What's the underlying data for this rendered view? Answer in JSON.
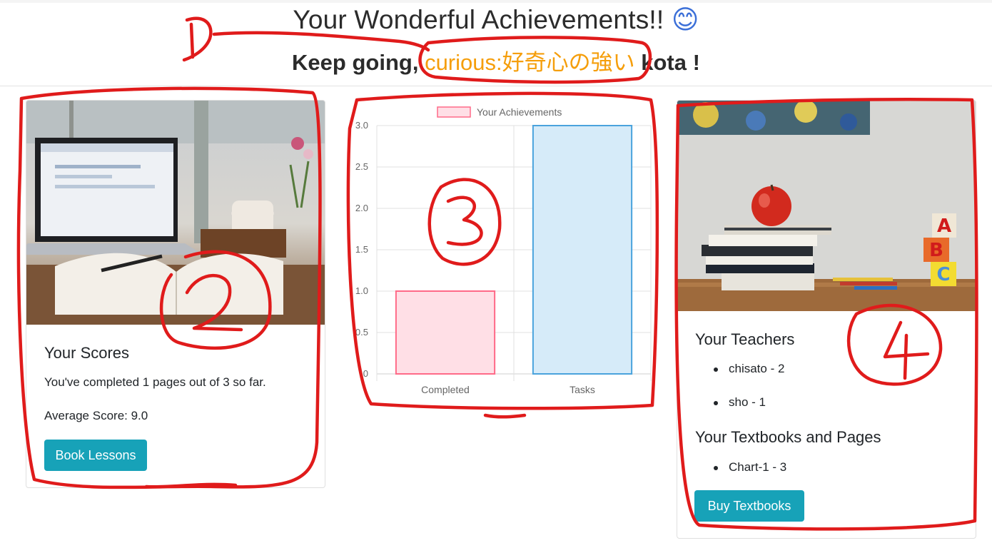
{
  "header": {
    "title": "Your Wonderful Achievements!!",
    "title_emoji": "😊",
    "sub_prefix": "Keep going,",
    "trait": "curious:好奇心の強い",
    "username": "kota",
    "sub_suffix": "!"
  },
  "scores_card": {
    "heading": "Your Scores",
    "progress_text": "You've completed 1 pages out of 3 so far.",
    "average_text": "Average Score: 9.0",
    "book_button": "Book Lessons"
  },
  "chart_data": {
    "type": "bar",
    "categories": [
      "Completed",
      "Tasks"
    ],
    "series": [
      {
        "name": "Your Achievements",
        "values": [
          1,
          3
        ]
      }
    ],
    "ylim": [
      0,
      3
    ],
    "yticks": [
      "0",
      "0.5",
      "1.0",
      "1.5",
      "2.0",
      "2.5",
      "3.0"
    ],
    "bar_colors": [
      {
        "fill": "#ffdfe6",
        "stroke": "#ff6a88"
      },
      {
        "fill": "#d6ebf9",
        "stroke": "#4aa3dd"
      }
    ],
    "grid": true,
    "legend": "top"
  },
  "teachers_card": {
    "teachers_heading": "Your Teachers",
    "teachers": [
      "chisato - 2",
      "sho - 1"
    ],
    "textbooks_heading": "Your Textbooks and Pages",
    "textbooks": [
      "Chart-1 - 3"
    ],
    "buy_button": "Buy Textbooks"
  },
  "annotations": [
    "1",
    "2",
    "3",
    "4"
  ],
  "colors": {
    "accent": "#17a2b8",
    "trait": "#f59e0b",
    "marker": "#e01b1b"
  },
  "icons": [
    "smiley-emoji",
    "laptop-desk-photo",
    "apple-books-photo"
  ]
}
